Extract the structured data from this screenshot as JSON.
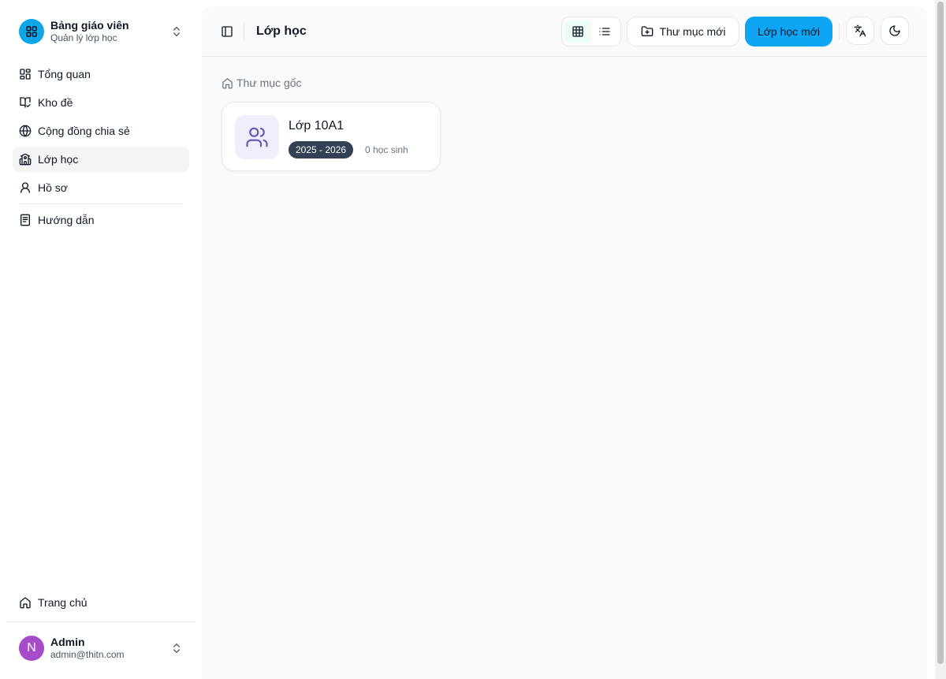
{
  "sidebar": {
    "brand": {
      "title": "Bảng giáo viên",
      "subtitle": "Quản lý lớp học",
      "logo_icon": "layout-grid-icon",
      "logo_color": "#0ea5e9"
    },
    "items": [
      {
        "label": "Tổng quan",
        "icon": "layout-dashboard-icon",
        "active": false
      },
      {
        "label": "Kho đề",
        "icon": "book-open-check-icon",
        "active": false
      },
      {
        "label": "Cộng đồng chia sẻ",
        "icon": "globe-icon",
        "active": false
      },
      {
        "label": "Lớp học",
        "icon": "school-icon",
        "active": true
      },
      {
        "label": "Hồ sơ",
        "icon": "user-icon",
        "active": false
      },
      {
        "label": "Hướng dẫn",
        "icon": "notebook-icon",
        "active": false
      }
    ],
    "home_label": "Trang chủ",
    "user": {
      "initial": "N",
      "name": "Admin",
      "email": "admin@thitn.com",
      "avatar_color": "#a64bc9"
    }
  },
  "header": {
    "title": "Lớp học",
    "view_mode": "grid",
    "new_folder_label": "Thư mục mới",
    "new_class_label": "Lớp học mới",
    "primary_color": "#0ea5f4"
  },
  "breadcrumb": {
    "root_label": "Thư mục gốc"
  },
  "classes": [
    {
      "name": "Lớp 10A1",
      "year": "2025 - 2026",
      "students": "0 học sinh",
      "icon": "users-icon"
    }
  ]
}
